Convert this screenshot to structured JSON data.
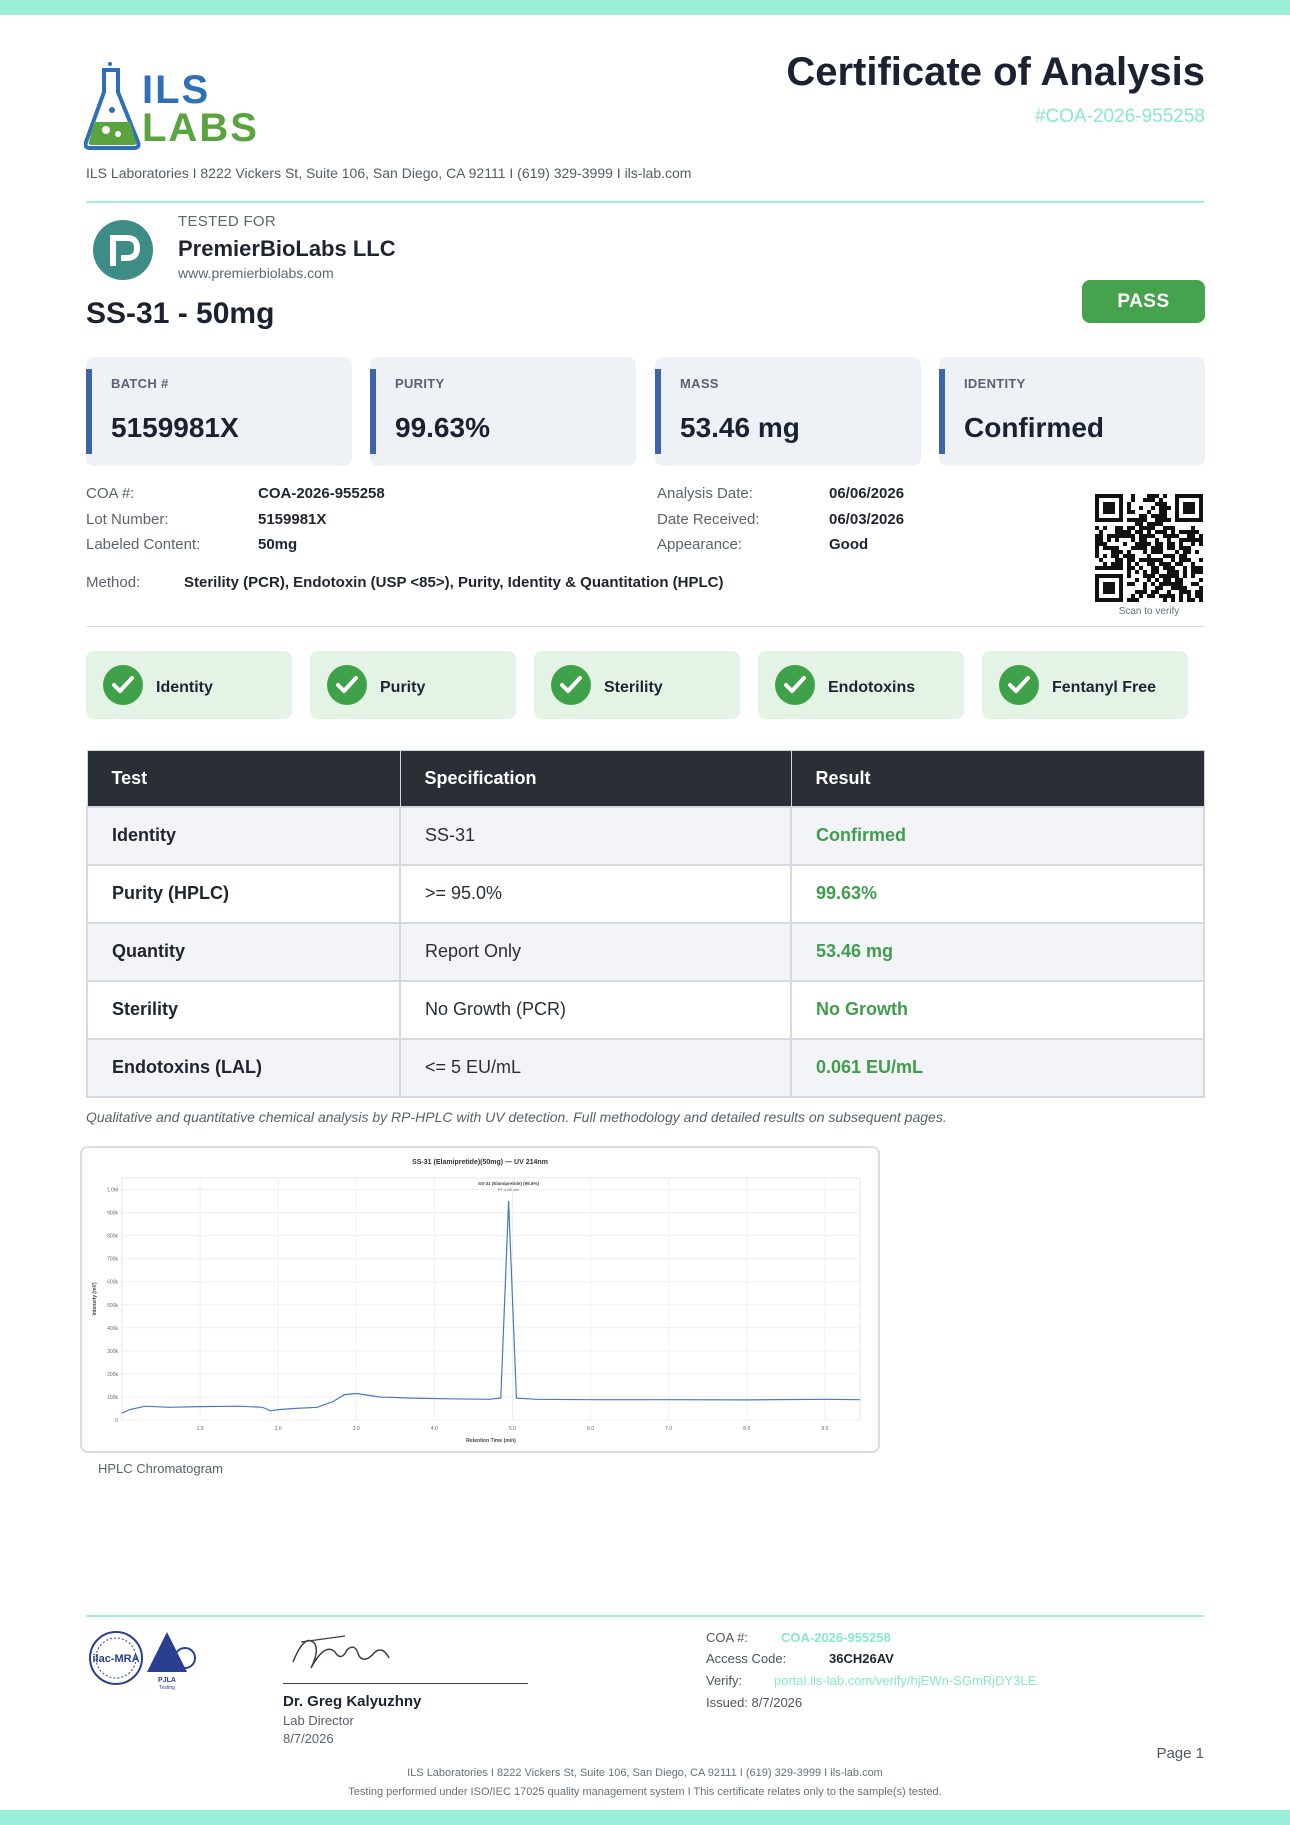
{
  "header": {
    "logo_line1": "ILS",
    "logo_line2": "LABS",
    "title": "Certificate of Analysis",
    "coa_id": "#COA-2026-955258",
    "lab_address": "ILS Laboratories  I  8222 Vickers St, Suite 106, San Diego, CA 92111  I  (619) 329-3999  I  ils-lab.com"
  },
  "client": {
    "tested_for_label": "TESTED FOR",
    "name": "PremierBioLabs LLC",
    "url": "www.premierbiolabs.com"
  },
  "product": {
    "name": "SS-31 - 50mg",
    "status": "PASS"
  },
  "stats": [
    {
      "label": "BATCH #",
      "value": "5159981X"
    },
    {
      "label": "PURITY",
      "value": "99.63%"
    },
    {
      "label": "MASS",
      "value": "53.46 mg"
    },
    {
      "label": "IDENTITY",
      "value": "Confirmed"
    }
  ],
  "details": {
    "coa_label": "COA #:",
    "coa_value": "COA-2026-955258",
    "lot_label": "Lot Number:",
    "lot_value": "5159981X",
    "labeled_label": "Labeled Content:",
    "labeled_value": "50mg",
    "analysis_label": "Analysis Date:",
    "analysis_value": "06/06/2026",
    "received_label": "Date Received:",
    "received_value": "06/03/2026",
    "appearance_label": "Appearance:",
    "appearance_value": "Good",
    "method_label": "Method:",
    "method_value": "Sterility (PCR), Endotoxin (USP <85>), Purity, Identity & Quantitation (HPLC)",
    "qr_caption": "Scan to verify"
  },
  "checks": [
    "Identity",
    "Purity",
    "Sterility",
    "Endotoxins",
    "Fentanyl Free"
  ],
  "table": {
    "headers": [
      "Test",
      "Specification",
      "Result"
    ],
    "rows": [
      {
        "test": "Identity",
        "spec": "SS-31",
        "result": "Confirmed"
      },
      {
        "test": "Purity (HPLC)",
        "spec": ">= 95.0%",
        "result": "99.63%"
      },
      {
        "test": "Quantity",
        "spec": "Report Only",
        "result": "53.46 mg"
      },
      {
        "test": "Sterility",
        "spec": "No Growth (PCR)",
        "result": "No Growth"
      },
      {
        "test": "Endotoxins (LAL)",
        "spec": "<= 5 EU/mL",
        "result": "0.061 EU/mL"
      }
    ],
    "footnote": "Qualitative and quantitative chemical analysis by RP-HPLC with UV detection. Full methodology and detailed results on subsequent pages."
  },
  "chromatogram": {
    "title": "SS-31 (Elamipretide)(50mg) — UV 214nm",
    "caption": "HPLC Chromatogram",
    "peak_label": "SS-31 (Elamipretide) (99.6%)",
    "peak_sublabel": "RT 4.95 min",
    "xlabel": "Retention Time (min)",
    "ylabel": "Intensity (mV)",
    "x_ticks": [
      "1.0",
      "2.0",
      "3.0",
      "4.0",
      "5.0",
      "6.0",
      "7.0",
      "8.0",
      "9.0"
    ],
    "y_ticks": [
      "0",
      "100k",
      "200k",
      "300k",
      "400k",
      "500k",
      "600k",
      "700k",
      "800k",
      "900k",
      "1.0M"
    ],
    "xlim": [
      0,
      9.45
    ],
    "ylim": [
      0,
      1050000
    ],
    "peak_x": 4.95,
    "peak_y": 950000,
    "baseline": [
      [
        0.0,
        30000
      ],
      [
        0.1,
        45000
      ],
      [
        0.3,
        60000
      ],
      [
        0.6,
        55000
      ],
      [
        1.0,
        58000
      ],
      [
        1.5,
        60000
      ],
      [
        1.8,
        55000
      ],
      [
        1.9,
        40000
      ],
      [
        2.0,
        45000
      ],
      [
        2.2,
        50000
      ],
      [
        2.5,
        55000
      ],
      [
        2.7,
        80000
      ],
      [
        2.85,
        110000
      ],
      [
        3.0,
        115000
      ],
      [
        3.3,
        100000
      ],
      [
        3.7,
        95000
      ],
      [
        4.2,
        92000
      ],
      [
        4.7,
        90000
      ],
      [
        4.85,
        95000
      ],
      [
        4.95,
        950000
      ],
      [
        5.05,
        95000
      ],
      [
        5.3,
        90000
      ],
      [
        6.0,
        88000
      ],
      [
        7.0,
        88000
      ],
      [
        8.0,
        87000
      ],
      [
        9.0,
        90000
      ],
      [
        9.45,
        88000
      ]
    ]
  },
  "footer": {
    "seal1": "ilac-MRA",
    "seal2": "PJLA",
    "seal2_sub": "Testing",
    "signer_name": "Dr. Greg Kalyuzhny",
    "signer_title": "Lab Director",
    "signer_date": "8/7/2026",
    "coa_label": "COA #:",
    "coa_value": "COA-2026-955258",
    "access_label": "Access Code:",
    "access_value": "36CH26AV",
    "verify_label": "Verify:",
    "verify_value": "portal.ils-lab.com/verify/hjEWn-SGmRjDY3LE",
    "issued": "Issued: 8/7/2026",
    "page": "Page 1",
    "line1": "ILS Laboratories  I  8222 Vickers St, Suite 106, San Diego, CA 92111  I  (619) 329-3999  I  ils-lab.com",
    "line2": "Testing performed under ISO/IEC 17025 quality management system  I  This certificate relates only to the sample(s) tested."
  },
  "colors": {
    "accent_teal": "#9cefd8",
    "pass_green": "#45a34e",
    "card_accent": "#3d63a8",
    "table_header": "#2a2f36",
    "result_green": "#3f9d4c"
  }
}
